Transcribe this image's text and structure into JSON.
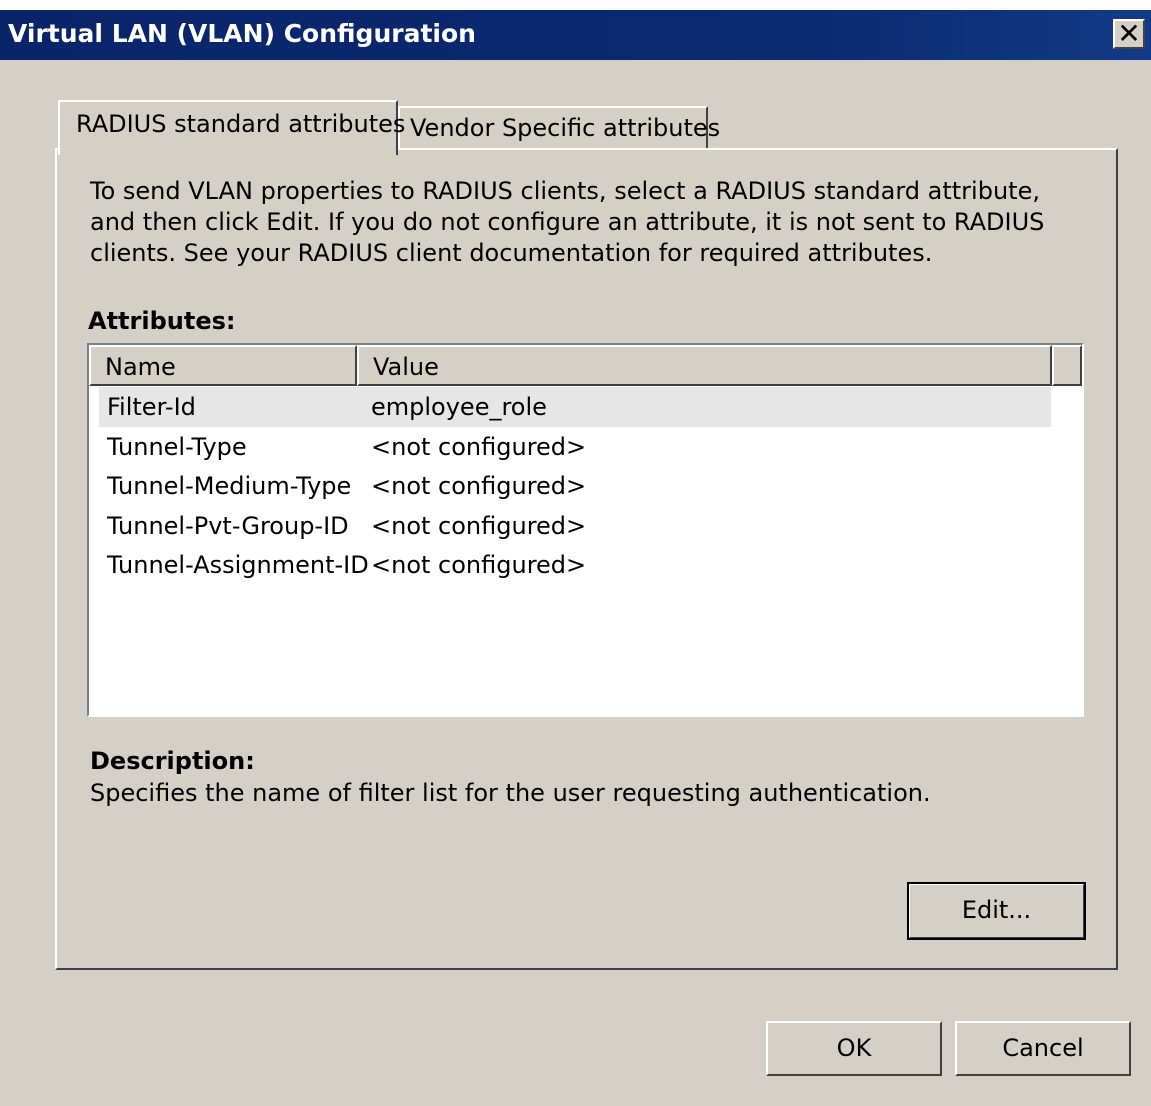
{
  "window": {
    "title": "Virtual LAN (VLAN) Configuration",
    "close_glyph": "✕"
  },
  "tabs": [
    {
      "label": "RADIUS standard attributes",
      "active": true
    },
    {
      "label": "Vendor Specific attributes",
      "active": false
    }
  ],
  "intro_text": "To send VLAN properties to RADIUS clients, select a RADIUS standard attribute, and then click Edit. If you do not configure an attribute, it is not sent to RADIUS clients. See your RADIUS client documentation for required attributes.",
  "attributes": {
    "label": "Attributes:",
    "columns": [
      "Name",
      "Value"
    ],
    "rows": [
      {
        "name": "Filter-Id",
        "value": "employee_role",
        "selected": true
      },
      {
        "name": "Tunnel-Type",
        "value": "<not configured>",
        "selected": false
      },
      {
        "name": "Tunnel-Medium-Type",
        "value": "<not configured>",
        "selected": false
      },
      {
        "name": "Tunnel-Pvt-Group-ID",
        "value": "<not configured>",
        "selected": false
      },
      {
        "name": "Tunnel-Assignment-ID",
        "value": "<not configured>",
        "selected": false
      }
    ]
  },
  "description": {
    "label": "Description:",
    "text": "Specifies the name of filter list for the user requesting authentication."
  },
  "buttons": {
    "edit": "Edit...",
    "ok": "OK",
    "cancel": "Cancel"
  }
}
